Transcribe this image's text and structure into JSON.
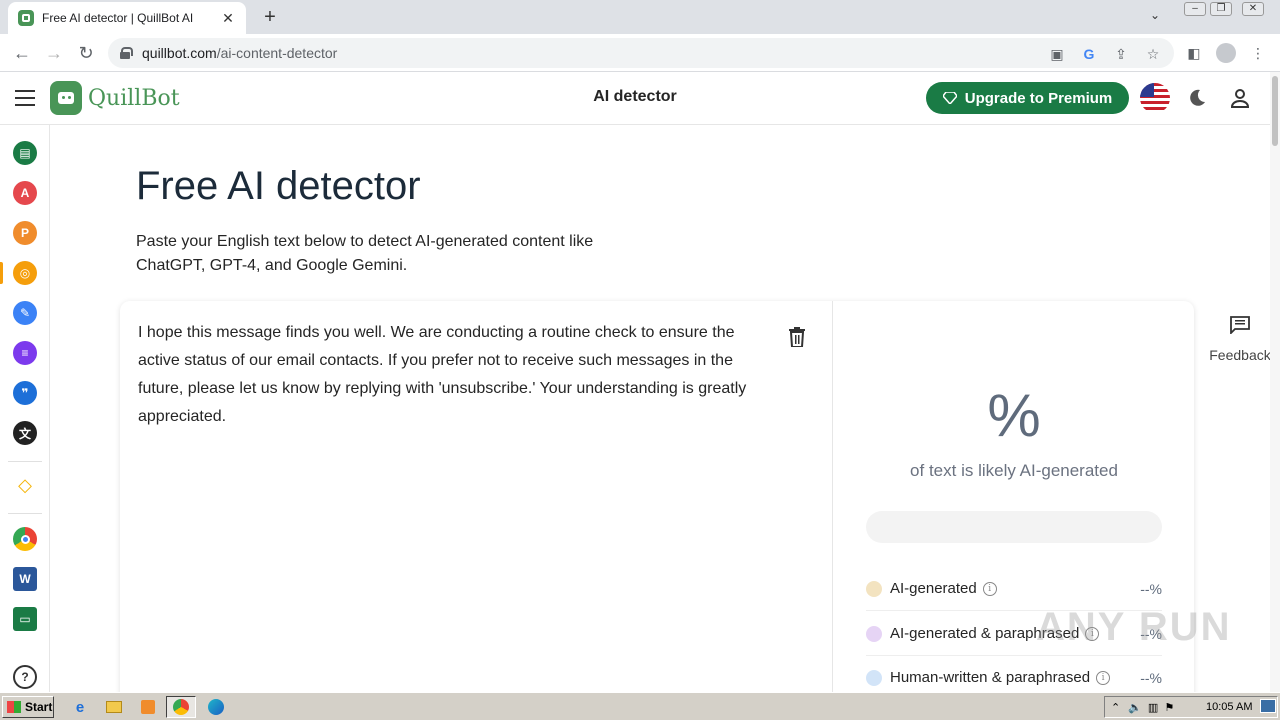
{
  "browser": {
    "tab_title": "Free AI detector | QuillBot AI",
    "tab_close": "✕",
    "new_tab": "+",
    "url_domain": "quillbot.com",
    "url_path": "/ai-content-detector",
    "tab_search": "⌄",
    "window_buttons": [
      "–",
      "❐",
      "✕"
    ]
  },
  "header": {
    "logo_text": "QuillBot",
    "title": "AI detector",
    "upgrade_label": "Upgrade to Premium"
  },
  "rail": {
    "items": [
      {
        "name": "paraphraser",
        "color": "#1a7b45"
      },
      {
        "name": "grammar-checker",
        "color": "#e5484d"
      },
      {
        "name": "plagiarism-checker",
        "color": "#f08c2c"
      },
      {
        "name": "ai-detector",
        "color": "#f59e0b"
      },
      {
        "name": "ai-humanizer",
        "color": "#3b82f6"
      },
      {
        "name": "summarizer",
        "color": "#7c3aed"
      },
      {
        "name": "citation-generator",
        "color": "#1d6fd8"
      },
      {
        "name": "translator",
        "color": "#222222"
      },
      {
        "name": "premium",
        "color": "#f5b50a"
      },
      {
        "name": "chrome-extension",
        "color": "#4285f4"
      },
      {
        "name": "word-extension",
        "color": "#2b579a"
      },
      {
        "name": "desktop-app",
        "color": "#1a7b45"
      },
      {
        "name": "help",
        "color": "#333333"
      }
    ]
  },
  "main": {
    "title": "Free AI detector",
    "subtitle": "Paste your English text below to detect AI-generated content like ChatGPT, GPT-4, and Google Gemini.",
    "input_text": "I hope this message finds you well. We are conducting a routine check to ensure the active status of our email contacts. If you prefer not to receive such messages in the future, please let us know by replying with 'unsubscribe.' Your understanding is greatly appreciated.",
    "result_percent": "%",
    "result_caption": "of text is likely AI-generated",
    "categories": [
      {
        "label": "AI-generated",
        "value": "--%",
        "color": "#f3e3c0"
      },
      {
        "label": "AI-generated & paraphrased",
        "value": "--%",
        "color": "#e6d4f5"
      },
      {
        "label": "Human-written & paraphrased",
        "value": "--%",
        "color": "#d2e4f8"
      }
    ],
    "feedback": "Feedback"
  },
  "watermark": "ANY RUN",
  "taskbar": {
    "start": "Start",
    "clock": "10:05 AM"
  }
}
